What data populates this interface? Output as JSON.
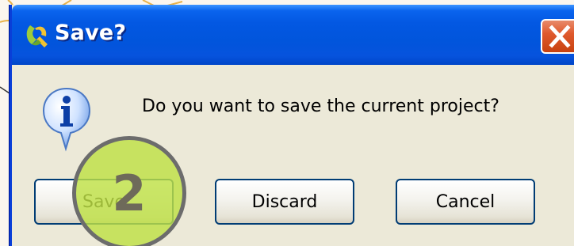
{
  "dialog": {
    "title": "Save?",
    "title_icon": "qgis-logo-icon",
    "close_icon": "close-icon",
    "message": "Do you want to save the current project?",
    "message_icon": "info-icon",
    "buttons": {
      "save": "Save",
      "discard": "Discard",
      "cancel": "Cancel"
    }
  },
  "overlay": {
    "step_number": "2",
    "color": "#bee046"
  },
  "colors": {
    "titlebar": "#0155dc",
    "close_button": "#e05a2e",
    "dialog_background": "#ece9d8"
  }
}
